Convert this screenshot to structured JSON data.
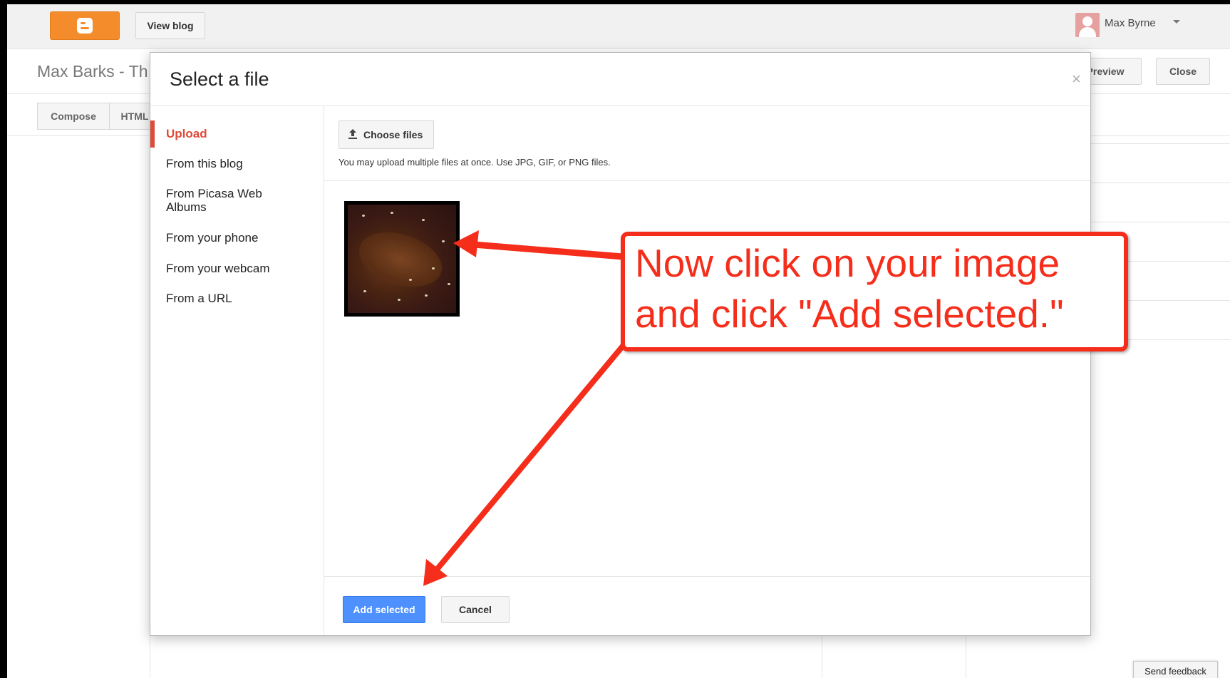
{
  "topbar": {
    "view_blog_label": "View blog",
    "user_name": "Max Byrne"
  },
  "editor": {
    "post_title": "Max Barks - Th",
    "preview_label": "Preview",
    "close_label": "Close",
    "compose_label": "Compose",
    "html_label": "HTML"
  },
  "dialog": {
    "title": "Select a file",
    "close_glyph": "×",
    "sources": [
      "Upload",
      "From this blog",
      "From Picasa Web Albums",
      "From your phone",
      "From your webcam",
      "From a URL"
    ],
    "active_source": "Upload",
    "choose_files_label": "Choose files",
    "upload_hint": "You may upload multiple files at once. Use JPG, GIF, or PNG files.",
    "add_selected_label": "Add selected",
    "cancel_label": "Cancel"
  },
  "callout": {
    "line1": "Now click on your image",
    "line2": "and click \"Add selected.\""
  },
  "feedback_label": "Send feedback",
  "colors": {
    "blogger_orange": "#f48c2b",
    "active_red": "#dd4b39",
    "primary_blue": "#4d90fe",
    "annotation_red": "#f52d1b"
  },
  "icons": [
    "blogger-logo-icon",
    "avatar-icon",
    "caret-down-icon",
    "close-icon",
    "upload-icon",
    "arrow-icon"
  ]
}
